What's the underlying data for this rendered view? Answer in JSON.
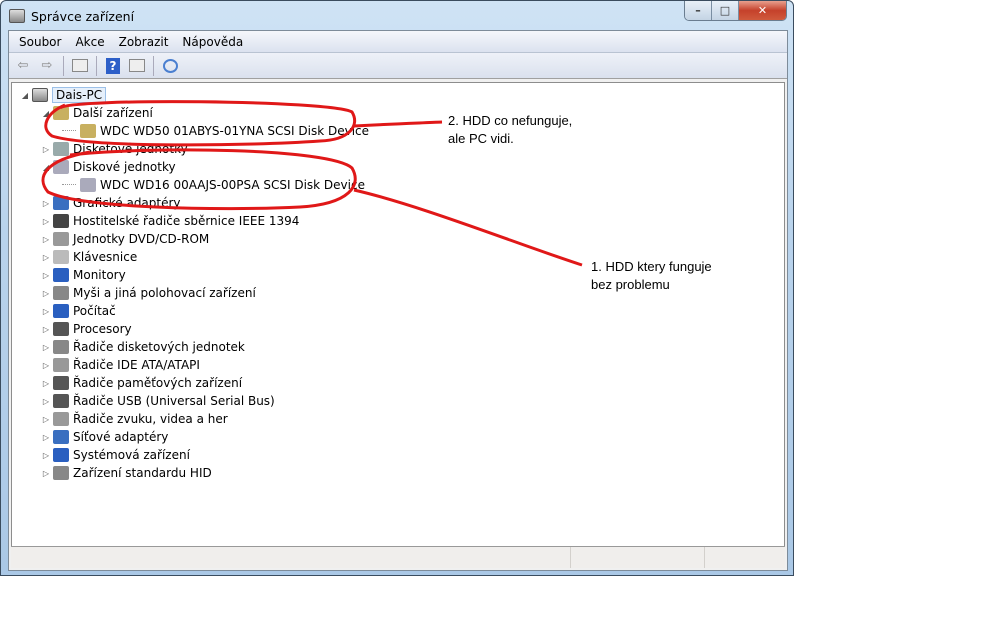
{
  "window": {
    "title": "Správce zařízení",
    "controls": {
      "minimize": "–",
      "maximize": "□",
      "close": "✕"
    }
  },
  "menu": [
    "Soubor",
    "Akce",
    "Zobrazit",
    "Nápověda"
  ],
  "toolbar": [
    "back-icon",
    "forward-icon",
    "show-hide-console-tree-icon",
    "help-icon",
    "properties-icon",
    "scan-hardware-icon"
  ],
  "tree": {
    "root": "Dais-PC",
    "items": [
      {
        "label": "Další zařízení",
        "level": 1,
        "expanded": true,
        "icon": "unknown-device-icon",
        "color": "#c8b060"
      },
      {
        "label": "WDC WD50 01ABYS-01YNA SCSI Disk Device",
        "level": 2,
        "icon": "unknown-device-icon",
        "color": "#c8b060"
      },
      {
        "label": "Disketové jednotky",
        "level": 1,
        "icon": "floppy-drive-icon",
        "color": "#9aa"
      },
      {
        "label": "Diskové jednotky",
        "level": 1,
        "expanded": true,
        "icon": "disk-drive-icon",
        "color": "#aab"
      },
      {
        "label": "WDC WD16 00AAJS-00PSA SCSI Disk Device",
        "level": 2,
        "icon": "disk-drive-icon",
        "color": "#aab"
      },
      {
        "label": "Grafické adaptéry",
        "level": 1,
        "icon": "display-adapter-icon",
        "color": "#3a6fc0"
      },
      {
        "label": "Hostitelské řadiče sběrnice IEEE 1394",
        "level": 1,
        "icon": "ieee1394-icon",
        "color": "#444"
      },
      {
        "label": "Jednotky DVD/CD-ROM",
        "level": 1,
        "icon": "dvd-drive-icon",
        "color": "#999"
      },
      {
        "label": "Klávesnice",
        "level": 1,
        "icon": "keyboard-icon",
        "color": "#bbb"
      },
      {
        "label": "Monitory",
        "level": 1,
        "icon": "monitor-icon",
        "color": "#2a5fc0"
      },
      {
        "label": "Myši a jiná polohovací zařízení",
        "level": 1,
        "icon": "mouse-icon",
        "color": "#888"
      },
      {
        "label": "Počítač",
        "level": 1,
        "icon": "computer-icon",
        "color": "#2a5fc0"
      },
      {
        "label": "Procesory",
        "level": 1,
        "icon": "processor-icon",
        "color": "#555"
      },
      {
        "label": "Řadiče disketových jednotek",
        "level": 1,
        "icon": "floppy-controller-icon",
        "color": "#888"
      },
      {
        "label": "Řadiče IDE ATA/ATAPI",
        "level": 1,
        "icon": "ide-controller-icon",
        "color": "#999"
      },
      {
        "label": "Řadiče paměťových zařízení",
        "level": 1,
        "icon": "storage-controller-icon",
        "color": "#555"
      },
      {
        "label": "Řadiče USB (Universal Serial Bus)",
        "level": 1,
        "icon": "usb-icon",
        "color": "#555"
      },
      {
        "label": "Řadiče zvuku, videa a her",
        "level": 1,
        "icon": "speaker-icon",
        "color": "#999"
      },
      {
        "label": "Síťové adaptéry",
        "level": 1,
        "icon": "network-adapter-icon",
        "color": "#3a6fc0"
      },
      {
        "label": "Systémová zařízení",
        "level": 1,
        "icon": "system-device-icon",
        "color": "#2a5fc0"
      },
      {
        "label": "Zařízení standardu HID",
        "level": 1,
        "icon": "hid-icon",
        "color": "#888"
      }
    ]
  },
  "annotations": {
    "note2": [
      "2. HDD co nefunguje,",
      "ale PC vidi."
    ],
    "note1": [
      "1. HDD ktery funguje",
      "bez problemu"
    ],
    "color": "#e01818"
  }
}
